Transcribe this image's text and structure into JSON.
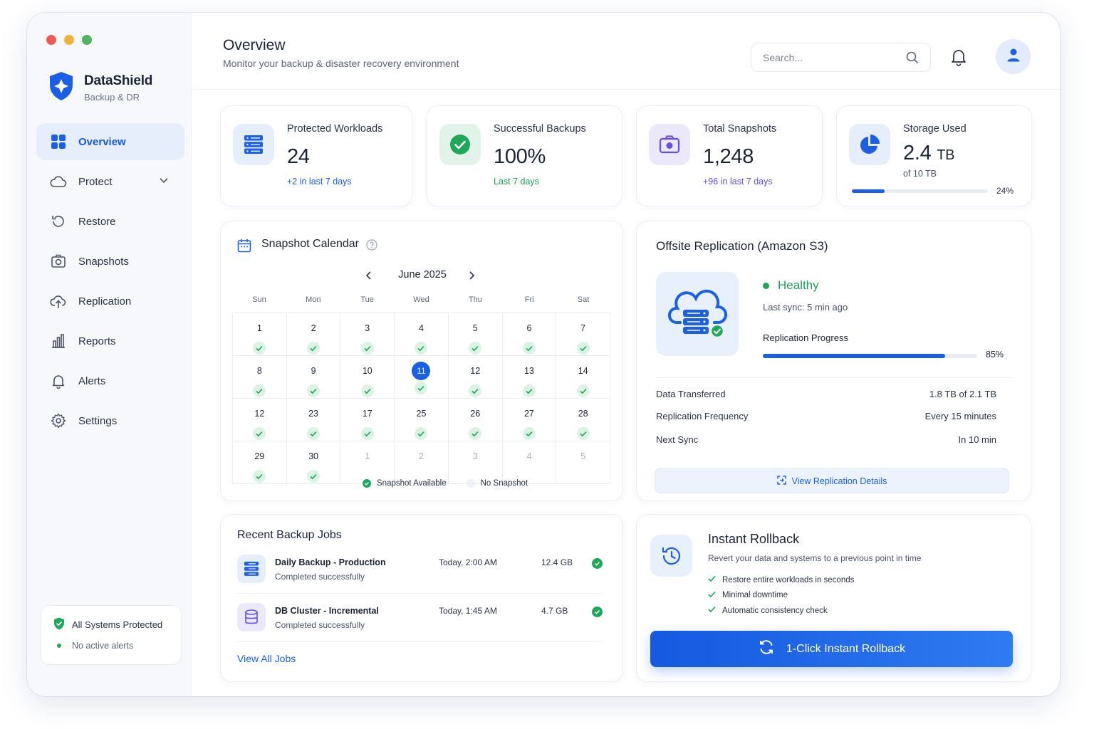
{
  "colors": {
    "accent": "#1a5fe6",
    "success": "#1fa85a",
    "purple": "#6a4ee0",
    "traffic_red": "#ee5b55",
    "traffic_yellow": "#f2b33c",
    "traffic_green": "#4fb55c"
  },
  "brand": {
    "name": "DataShield",
    "subtitle": "Backup & DR"
  },
  "sidebar": {
    "items": [
      {
        "label": "Overview",
        "icon": "grid-icon",
        "active": true
      },
      {
        "label": "Protect",
        "icon": "cloud-icon",
        "has_chevron": true
      },
      {
        "label": "Restore",
        "icon": "restore-icon"
      },
      {
        "label": "Snapshots",
        "icon": "camera-icon"
      },
      {
        "label": "Replication",
        "icon": "cloud-upload-icon"
      },
      {
        "label": "Reports",
        "icon": "bar-chart-icon"
      },
      {
        "label": "Alerts",
        "icon": "bell-icon"
      },
      {
        "label": "Settings",
        "icon": "gear-icon"
      }
    ],
    "status": {
      "title": "All Systems Protected",
      "subtitle": "No active alerts"
    }
  },
  "header": {
    "title": "Overview",
    "subtitle": "Monitor your backup & disaster recovery environment",
    "search_placeholder": "Search..."
  },
  "stats": [
    {
      "label": "Protected Workloads",
      "value": "24",
      "note": "+2 in last 7 days",
      "icon": "server-icon"
    },
    {
      "label": "Successful Backups",
      "value": "100%",
      "note": "Last 7 days",
      "icon": "check-circle-icon"
    },
    {
      "label": "Total Snapshots",
      "value": "1,248",
      "note": "+96 in last 7 days",
      "icon": "camera-icon"
    },
    {
      "label": "Storage Used",
      "value": "2.4",
      "unit": "TB",
      "note": "of 10 TB",
      "percent": "24%",
      "fraction": 0.24,
      "icon": "pie-chart-icon"
    }
  ],
  "calendar": {
    "title": "Snapshot Calendar",
    "month": "June 2025",
    "weekdays": [
      "Sun",
      "Mon",
      "Tue",
      "Wed",
      "Thu",
      "Fri",
      "Sat"
    ],
    "days": [
      {
        "d": "1",
        "snap": true
      },
      {
        "d": "2",
        "snap": true
      },
      {
        "d": "3",
        "snap": true
      },
      {
        "d": "4",
        "snap": true
      },
      {
        "d": "5",
        "snap": true
      },
      {
        "d": "6",
        "snap": true
      },
      {
        "d": "7",
        "snap": true
      },
      {
        "d": "8",
        "snap": true
      },
      {
        "d": "9",
        "snap": true
      },
      {
        "d": "10",
        "snap": true
      },
      {
        "d": "11",
        "snap": true,
        "today": true
      },
      {
        "d": "12",
        "snap": true
      },
      {
        "d": "13",
        "snap": true
      },
      {
        "d": "14",
        "snap": true
      },
      {
        "d": "12",
        "snap": true
      },
      {
        "d": "23",
        "snap": true
      },
      {
        "d": "17",
        "snap": true
      },
      {
        "d": "25",
        "snap": true
      },
      {
        "d": "26",
        "snap": true
      },
      {
        "d": "27",
        "snap": true
      },
      {
        "d": "28",
        "snap": true
      },
      {
        "d": "29",
        "snap": true
      },
      {
        "d": "30",
        "snap": true
      },
      {
        "d": "1",
        "other": true
      },
      {
        "d": "2",
        "other": true
      },
      {
        "d": "3",
        "other": true
      },
      {
        "d": "4",
        "other": true
      },
      {
        "d": "5",
        "other": true
      }
    ],
    "legend": {
      "available": "Snapshot Available",
      "none": "No Snapshot"
    }
  },
  "replication": {
    "title": "Offsite Replication (Amazon S3)",
    "status": "Healthy",
    "last_sync": "Last sync: 5 min ago",
    "progress_label": "Replication Progress",
    "progress_pct": "85%",
    "progress_fraction": 0.85,
    "rows": [
      {
        "k": "Data Transferred",
        "v": "1.8 TB of 2.1 TB"
      },
      {
        "k": "Replication Frequency",
        "v": "Every 15 minutes"
      },
      {
        "k": "Next Sync",
        "v": "In 10 min"
      }
    ],
    "button": "View Replication Details"
  },
  "jobs": {
    "title": "Recent Backup Jobs",
    "items": [
      {
        "name": "Daily Backup - Production",
        "status": "Completed successfully",
        "time": "Today, 2:00 AM",
        "size": "12.4 GB",
        "icon": "server-icon"
      },
      {
        "name": "DB Cluster - Incremental",
        "status": "Completed successfully",
        "time": "Today, 1:45 AM",
        "size": "4.7 GB",
        "icon": "database-icon"
      }
    ],
    "link": "View All Jobs"
  },
  "rollback": {
    "title": "Instant Rollback",
    "subtitle": "Revert your data and systems to a previous point in time",
    "bullets": [
      "Restore entire workloads in seconds",
      "Minimal downtime",
      "Automatic consistency check"
    ],
    "button": "1-Click Instant Rollback"
  }
}
